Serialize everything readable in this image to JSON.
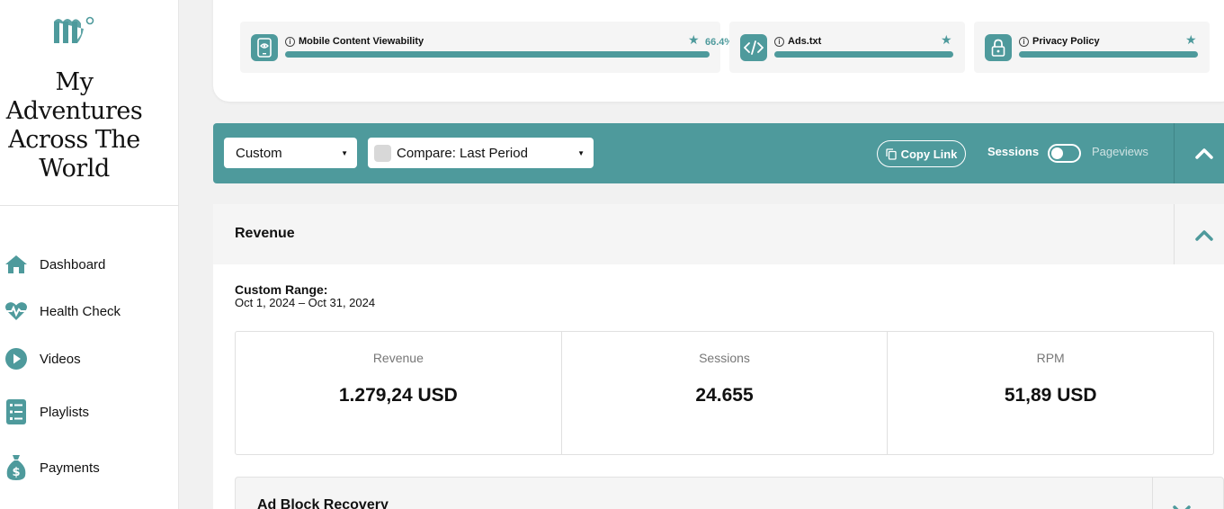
{
  "site": {
    "title": "My Adventures Across The World"
  },
  "sidebar": {
    "items": [
      {
        "label": "Dashboard",
        "icon": "home-icon"
      },
      {
        "label": "Health Check",
        "icon": "heartbeat-icon"
      },
      {
        "label": "Videos",
        "icon": "play-icon"
      },
      {
        "label": "Playlists",
        "icon": "list-icon"
      },
      {
        "label": "Payments",
        "icon": "money-bag-icon"
      }
    ]
  },
  "health": {
    "tiles": [
      {
        "label": "Mobile Content Viewability",
        "value": "66.4%",
        "icon": "mobile-eye-icon"
      },
      {
        "label": "Ads.txt",
        "icon": "code-icon"
      },
      {
        "label": "Privacy Policy",
        "icon": "lock-icon"
      }
    ]
  },
  "filters": {
    "period": "Custom",
    "compare": "Compare: Last Period",
    "copy_link": "Copy Link",
    "toggle_left": "Sessions",
    "toggle_right": "Pageviews"
  },
  "revenue": {
    "title": "Revenue",
    "range_label": "Custom Range:",
    "range_value": "Oct 1, 2024 – Oct 31, 2024",
    "stats": [
      {
        "label": "Revenue",
        "value": "1.279,24 USD"
      },
      {
        "label": "Sessions",
        "value": "24.655"
      },
      {
        "label": "RPM",
        "value": "51,89 USD"
      }
    ]
  },
  "adblock": {
    "title": "Ad Block Recovery"
  },
  "colors": {
    "accent": "#4e9a9c"
  }
}
